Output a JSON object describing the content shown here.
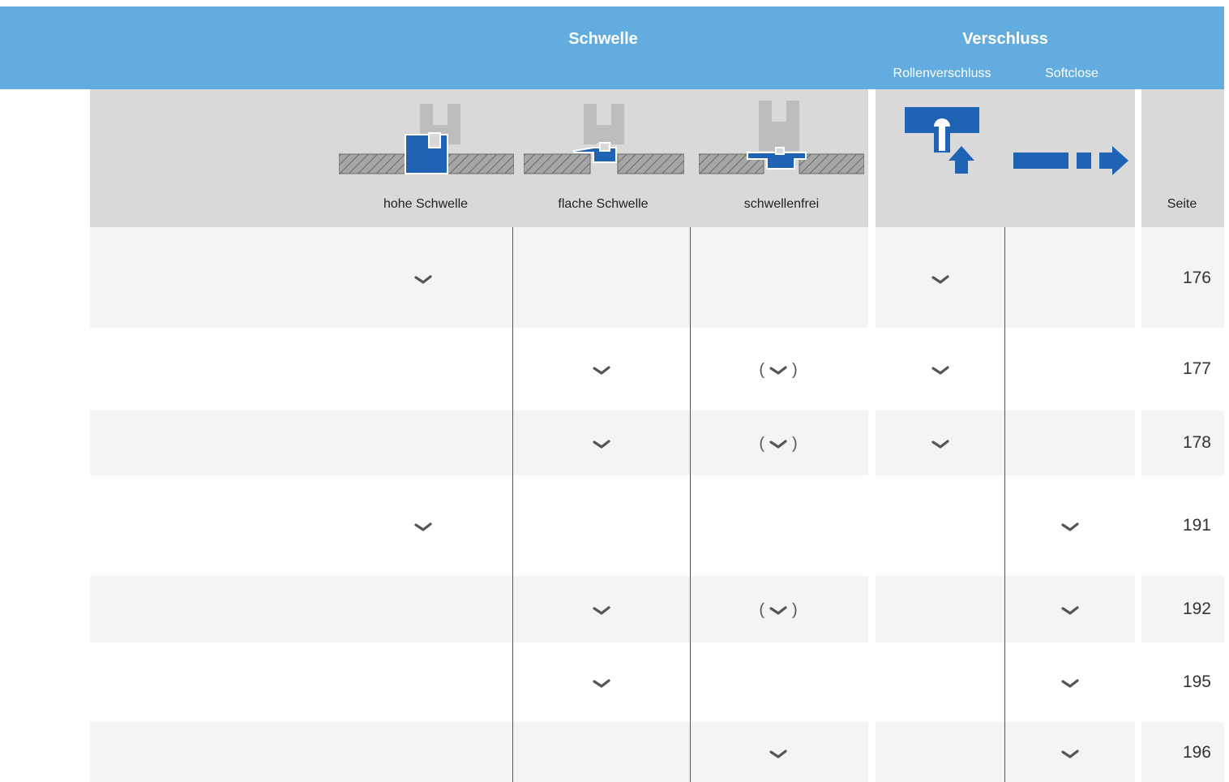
{
  "header": {
    "schwelle_title": "Schwelle",
    "verschluss_title": "Verschluss",
    "rollen_label": "Rollenverschluss",
    "softclose_label": "Softclose",
    "col_hohe": "hohe Schwelle",
    "col_flache": "flache Schwelle",
    "col_frei": "schwellenfrei",
    "col_seite": "Seite"
  },
  "colors": {
    "banner": "#62acdf",
    "icon_blue": "#1e63b4",
    "header_gray": "#d9d9d9",
    "row_gray": "#f4f4f4"
  },
  "legend": {
    "check": "✓",
    "partial_check": "(✓)"
  },
  "rows": [
    {
      "hohe": "check",
      "flache": "",
      "frei": "",
      "rollen": "check",
      "softclose": "",
      "seite": "176"
    },
    {
      "hohe": "",
      "flache": "check",
      "frei": "partial",
      "rollen": "check",
      "softclose": "",
      "seite": "177"
    },
    {
      "hohe": "",
      "flache": "check",
      "frei": "partial",
      "rollen": "check",
      "softclose": "",
      "seite": "178"
    },
    {
      "hohe": "check",
      "flache": "",
      "frei": "",
      "rollen": "",
      "softclose": "check",
      "seite": "191"
    },
    {
      "hohe": "",
      "flache": "check",
      "frei": "partial",
      "rollen": "",
      "softclose": "check",
      "seite": "192"
    },
    {
      "hohe": "",
      "flache": "check",
      "frei": "",
      "rollen": "",
      "softclose": "check",
      "seite": "195"
    },
    {
      "hohe": "",
      "flache": "",
      "frei": "check",
      "rollen": "",
      "softclose": "check",
      "seite": "196"
    }
  ]
}
